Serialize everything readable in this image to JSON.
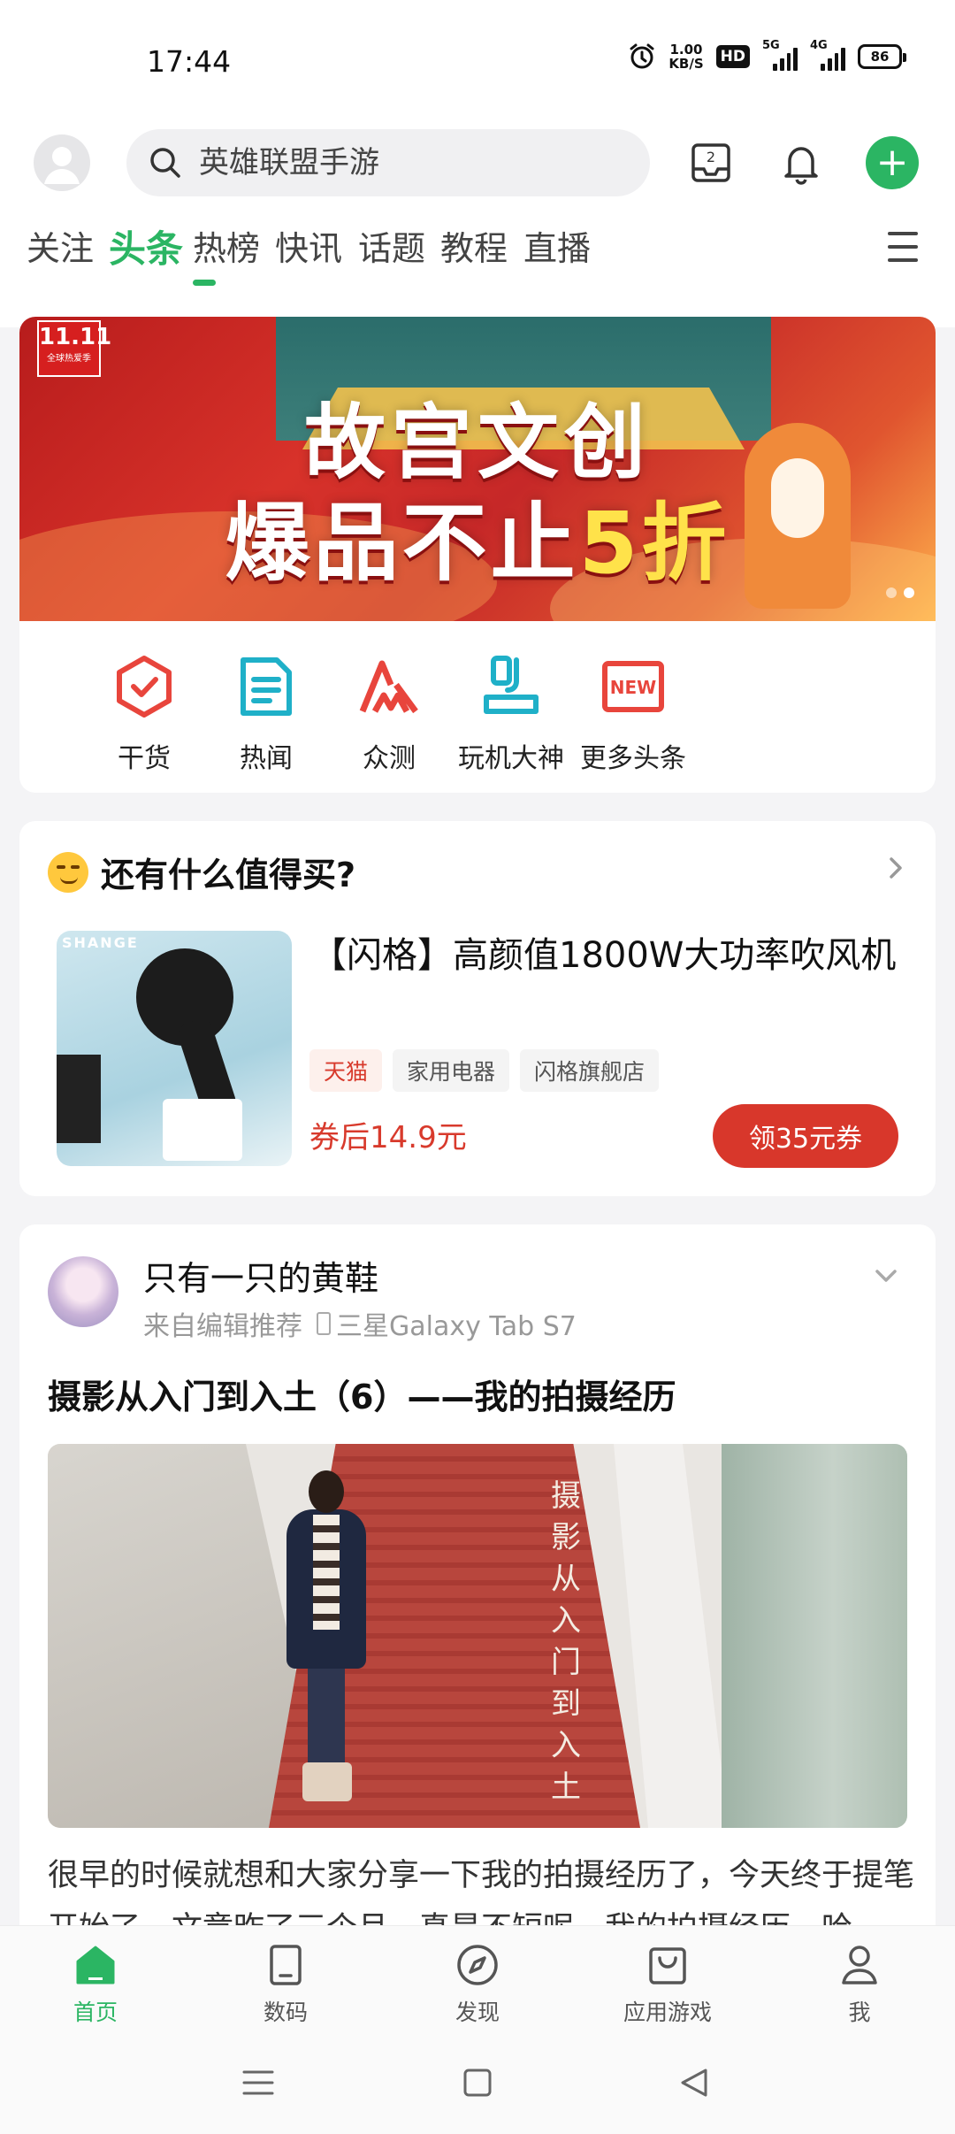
{
  "status_bar": {
    "time": "17:44",
    "net_speed_value": "1.00",
    "net_speed_unit": "KB/S",
    "hd_label": "HD",
    "sim1_label": "5G",
    "sim2_label": "4G",
    "battery": "86"
  },
  "header": {
    "search_placeholder": "英雄联盟手游",
    "inbox_count": "2"
  },
  "tabs": [
    "关注",
    "头条",
    "热榜",
    "快讯",
    "话题",
    "教程",
    "直播"
  ],
  "active_tab_index": 1,
  "banner": {
    "badge_top": "11.11",
    "badge_bottom": "全球热爱季",
    "title": "故宫文创",
    "subtitle_pre": "爆品不止",
    "subtitle_highlight": "5折"
  },
  "quick_links": [
    "干货",
    "热闻",
    "众测",
    "玩机大神",
    "更多头条"
  ],
  "shop": {
    "section_title": "还有什么值得买?",
    "brand_mark": "SHANGE",
    "product_name": "【闪格】高颜值1800W大功率吹风机",
    "tags": [
      "天猫",
      "家用电器",
      "闪格旗舰店"
    ],
    "price": "券后14.9元",
    "coupon_button": "领35元券"
  },
  "post": {
    "author": "只有一只的黄鞋",
    "source": "来自编辑推荐",
    "device": "三星Galaxy Tab S7",
    "title": "摄影从入门到入土（6）——我的拍摄经历",
    "image_text": "摄影从入门到入土",
    "body": "很早的时候就想和大家分享一下我的拍摄经历了，今天终于提笔开始了，文章昨了三个月，真是不短呢，我的拍摄经历，哈"
  },
  "bottom_nav": [
    "首页",
    "数码",
    "发现",
    "应用游戏",
    "我"
  ],
  "colors": {
    "brand_green": "#2bb563",
    "accent_red": "#d8372b"
  }
}
